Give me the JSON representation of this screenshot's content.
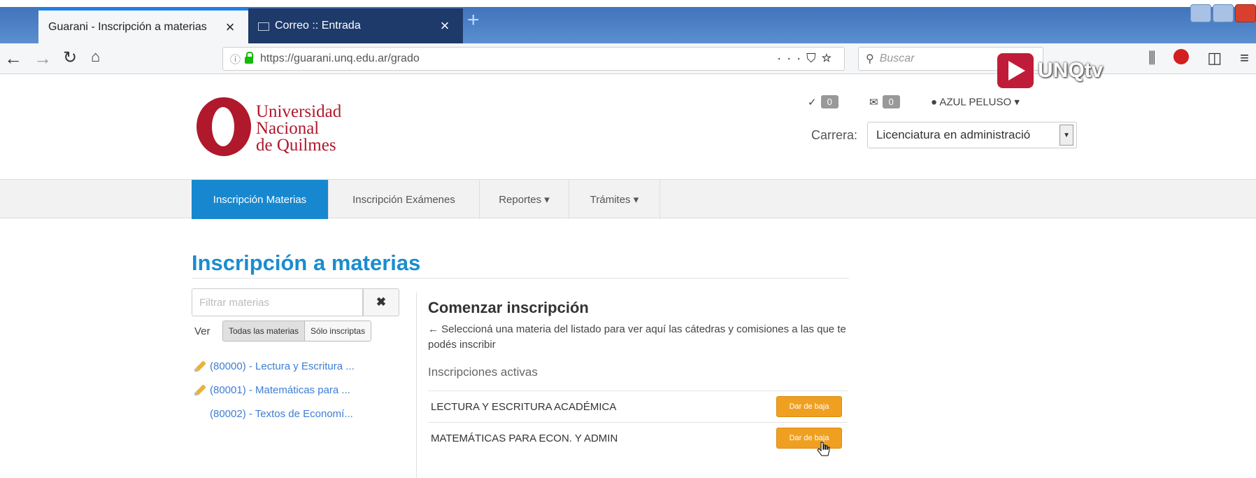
{
  "browser": {
    "tabs": [
      {
        "title": "Guarani - Inscripción a materias",
        "active": true
      },
      {
        "title": "Correo :: Entrada",
        "active": false
      }
    ],
    "url": "https://guarani.unq.edu.ar/grado",
    "search_placeholder": "Buscar"
  },
  "overlay": {
    "brand": "UNQtv"
  },
  "header": {
    "logo_lines": [
      "Universidad",
      "Nacional",
      "de Quilmes"
    ],
    "tasks_count": "0",
    "messages_count": "0",
    "user_name": "AZUL PELUSO",
    "carrera_label": "Carrera:",
    "carrera_value": "Licenciatura en administració"
  },
  "nav": {
    "items": [
      {
        "label": "Inscripción Materias",
        "active": true
      },
      {
        "label": "Inscripción Exámenes"
      },
      {
        "label": "Reportes ▾"
      },
      {
        "label": "Trámites ▾"
      }
    ]
  },
  "main": {
    "title": "Inscripción a materias",
    "filter_placeholder": "Filtrar materias",
    "ver_label": "Ver",
    "toggle": [
      "Todas las materias",
      "Sólo inscriptas"
    ],
    "materias": [
      {
        "label": "(80000) - Lectura y Escritura ...",
        "enrolled": true
      },
      {
        "label": "(80001) - Matemáticas para ...",
        "enrolled": true
      },
      {
        "label": "(80002) - Textos de Economí...",
        "enrolled": false
      }
    ],
    "panel": {
      "heading": "Comenzar inscripción",
      "instruction": "Seleccioná una materia del listado para ver aquí las cátedras y comisiones a las que te podés inscribir",
      "activas_label": "Inscripciones activas",
      "activas": [
        {
          "name": "LECTURA Y ESCRITURA ACADÉMICA",
          "button": "Dar de baja"
        },
        {
          "name": "MATEMÁTICAS PARA ECON. Y ADMIN",
          "button": "Dar de baja"
        }
      ]
    }
  },
  "colors": {
    "accent": "#1788d0",
    "brand": "#b0182c",
    "warning": "#f0a020"
  }
}
